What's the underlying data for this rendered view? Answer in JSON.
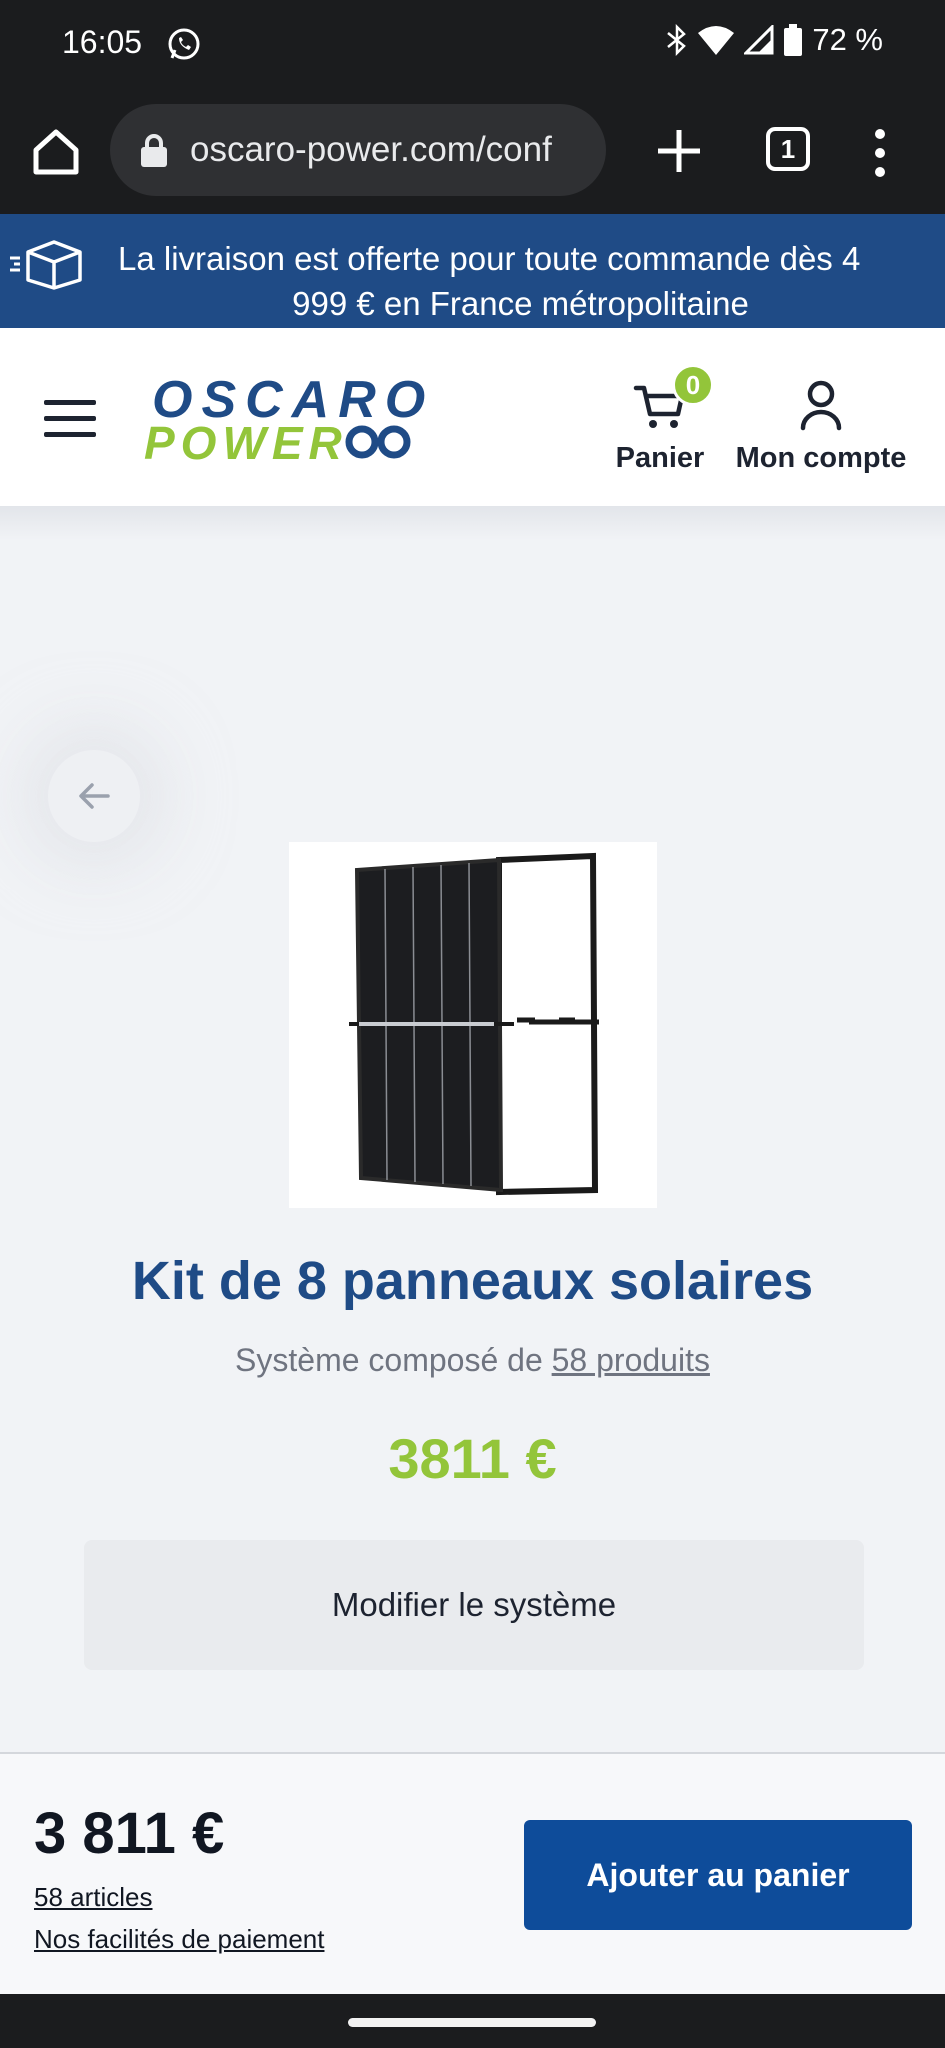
{
  "status_bar": {
    "time": "16:05",
    "battery": "72 %",
    "icons": [
      "whatsapp-icon",
      "bluetooth-icon",
      "wifi-icon",
      "signal-icon",
      "battery-icon"
    ]
  },
  "browser": {
    "url": "oscaro-power.com/conf",
    "tab_count": "1"
  },
  "promo": {
    "line1": "La livraison est offerte pour toute commande dès 4",
    "line2": "999 € en France métropolitaine"
  },
  "header": {
    "logo_line1": "OSCARO",
    "logo_line2": "POWER",
    "cart_label": "Panier",
    "cart_count": "0",
    "account_label": "Mon compte"
  },
  "product": {
    "title": "Kit de 8 panneaux solaires",
    "subtitle_prefix": "Système composé de ",
    "subtitle_link": "58 produits",
    "price": "3811 €",
    "modify_label": "Modifier le système"
  },
  "footer": {
    "total": "3 811 €",
    "articles_link": "58 articles",
    "payment_link": "Nos facilités de paiement",
    "add_to_cart": "Ajouter au panier"
  },
  "colors": {
    "brand_blue": "#1f4b86",
    "brand_green": "#93c53a",
    "button_blue": "#0e4c9a"
  }
}
